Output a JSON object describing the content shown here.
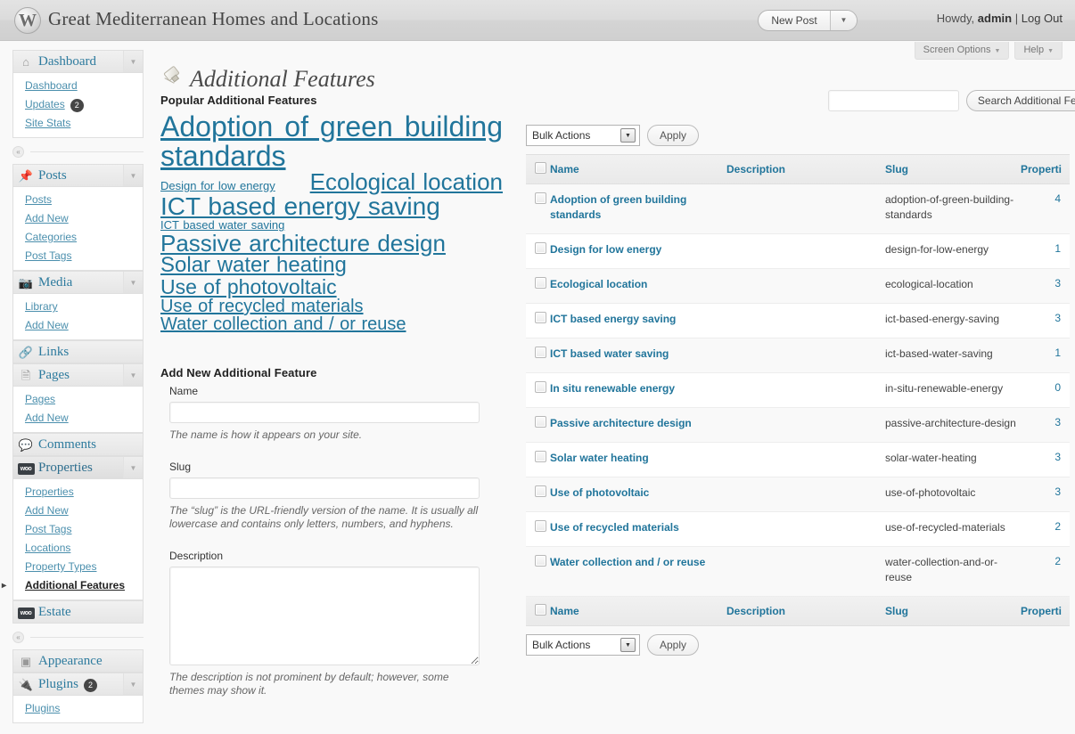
{
  "adminbar": {
    "site_title": "Great Mediterranean Homes and Locations",
    "logo_icon": "wordpress-logo-icon",
    "new_post_label": "New Post",
    "new_post_caret": "▼",
    "howdy_prefix": "Howdy,",
    "username": "admin",
    "separator": "|",
    "logout_label": "Log Out"
  },
  "screen_meta": {
    "screen_options": "Screen Options",
    "help": "Help",
    "caret": "▼"
  },
  "sidebar": {
    "collapse_glyph": "«",
    "groups": [
      {
        "label": "Dashboard",
        "icon": "home-icon",
        "has_arrow": true,
        "current": false,
        "sub": [
          {
            "label": "Dashboard",
            "current": false,
            "badge": null
          },
          {
            "label": "Updates",
            "current": false,
            "badge": "2"
          },
          {
            "label": "Site Stats",
            "current": false,
            "badge": null
          }
        ]
      },
      {
        "label": "Posts",
        "icon": "pin-icon",
        "has_arrow": true,
        "current": false,
        "sub": [
          {
            "label": "Posts",
            "current": false,
            "badge": null
          },
          {
            "label": "Add New",
            "current": false,
            "badge": null
          },
          {
            "label": "Categories",
            "current": false,
            "badge": null
          },
          {
            "label": "Post Tags",
            "current": false,
            "badge": null
          }
        ]
      },
      {
        "label": "Media",
        "icon": "media-icon",
        "has_arrow": true,
        "current": false,
        "sub": [
          {
            "label": "Library",
            "current": false,
            "badge": null
          },
          {
            "label": "Add New",
            "current": false,
            "badge": null
          }
        ]
      },
      {
        "label": "Links",
        "icon": "link-icon",
        "has_arrow": false,
        "current": false,
        "sub": []
      },
      {
        "label": "Pages",
        "icon": "pages-icon",
        "has_arrow": true,
        "current": false,
        "sub": [
          {
            "label": "Pages",
            "current": false,
            "badge": null
          },
          {
            "label": "Add New",
            "current": false,
            "badge": null
          }
        ]
      },
      {
        "label": "Comments",
        "icon": "comment-icon",
        "has_arrow": false,
        "current": false,
        "sub": []
      },
      {
        "label": "Properties",
        "icon": "woo-icon",
        "has_arrow": true,
        "current": true,
        "sub": [
          {
            "label": "Properties",
            "current": false,
            "badge": null
          },
          {
            "label": "Add New",
            "current": false,
            "badge": null
          },
          {
            "label": "Post Tags",
            "current": false,
            "badge": null
          },
          {
            "label": "Locations",
            "current": false,
            "badge": null
          },
          {
            "label": "Property Types",
            "current": false,
            "badge": null
          },
          {
            "label": "Additional Features",
            "current": true,
            "badge": null
          }
        ]
      },
      {
        "label": "Estate",
        "icon": "woo-icon",
        "has_arrow": false,
        "current": false,
        "sub": []
      }
    ],
    "groups2": [
      {
        "label": "Appearance",
        "icon": "appearance-icon",
        "has_arrow": false,
        "current": false,
        "badge": null,
        "sub": []
      },
      {
        "label": "Plugins",
        "icon": "plugin-icon",
        "has_arrow": true,
        "current": false,
        "badge": "2",
        "sub": [
          {
            "label": "Plugins",
            "current": false,
            "badge": null
          }
        ]
      }
    ]
  },
  "page": {
    "title": "Additional Features",
    "title_icon": "pin-icon"
  },
  "popular": {
    "heading": "Popular Additional Features",
    "tags": [
      {
        "label": "Adoption of green building standards",
        "size": 32
      },
      {
        "label": "Design for low energy",
        "size": 13
      },
      {
        "label": "Ecological location",
        "size": 26
      },
      {
        "label": "ICT based energy saving",
        "size": 28
      },
      {
        "label": "ICT based water saving",
        "size": 13
      },
      {
        "label": "Passive architecture design",
        "size": 26
      },
      {
        "label": "Solar water heating",
        "size": 24
      },
      {
        "label": "Use of photovoltaic",
        "size": 23
      },
      {
        "label": "Use of recycled materials",
        "size": 20
      },
      {
        "label": "Water collection and / or reuse",
        "size": 20
      }
    ]
  },
  "add_form": {
    "heading": "Add New Additional Feature",
    "name_label": "Name",
    "name_value": "",
    "name_help": "The name is how it appears on your site.",
    "slug_label": "Slug",
    "slug_value": "",
    "slug_help": "The “slug” is the URL-friendly version of the name. It is usually all lowercase and contains only letters, numbers, and hyphens.",
    "description_label": "Description",
    "description_value": "",
    "description_help": "The description is not prominent by default; however, some themes may show it."
  },
  "search": {
    "value": "",
    "button_label": "Search Additional Features"
  },
  "tablenav": {
    "bulk_label": "Bulk Actions",
    "bulk_caret": "▼",
    "apply_label": "Apply"
  },
  "table": {
    "columns": [
      "Name",
      "Description",
      "Slug",
      "Properti"
    ],
    "rows": [
      {
        "name": "Adoption of green building standards",
        "description": "",
        "slug": "adoption-of-green-building-standards",
        "count": "4"
      },
      {
        "name": "Design for low energy",
        "description": "",
        "slug": "design-for-low-energy",
        "count": "1"
      },
      {
        "name": "Ecological location",
        "description": "",
        "slug": "ecological-location",
        "count": "3"
      },
      {
        "name": "ICT based energy saving",
        "description": "",
        "slug": "ict-based-energy-saving",
        "count": "3"
      },
      {
        "name": "ICT based water saving",
        "description": "",
        "slug": "ict-based-water-saving",
        "count": "1"
      },
      {
        "name": "In situ renewable energy",
        "description": "",
        "slug": "in-situ-renewable-energy",
        "count": "0"
      },
      {
        "name": "Passive architecture design",
        "description": "",
        "slug": "passive-architecture-design",
        "count": "3"
      },
      {
        "name": "Solar water heating",
        "description": "",
        "slug": "solar-water-heating",
        "count": "3"
      },
      {
        "name": "Use of photovoltaic",
        "description": "",
        "slug": "use-of-photovoltaic",
        "count": "3"
      },
      {
        "name": "Use of recycled materials",
        "description": "",
        "slug": "use-of-recycled-materials",
        "count": "2"
      },
      {
        "name": "Water collection and / or reuse",
        "description": "",
        "slug": "water-collection-and-or-reuse",
        "count": "2"
      }
    ]
  },
  "colors": {
    "link": "#21759b",
    "sidebar_link": "#4b8fad",
    "badge_bg": "#464646"
  }
}
